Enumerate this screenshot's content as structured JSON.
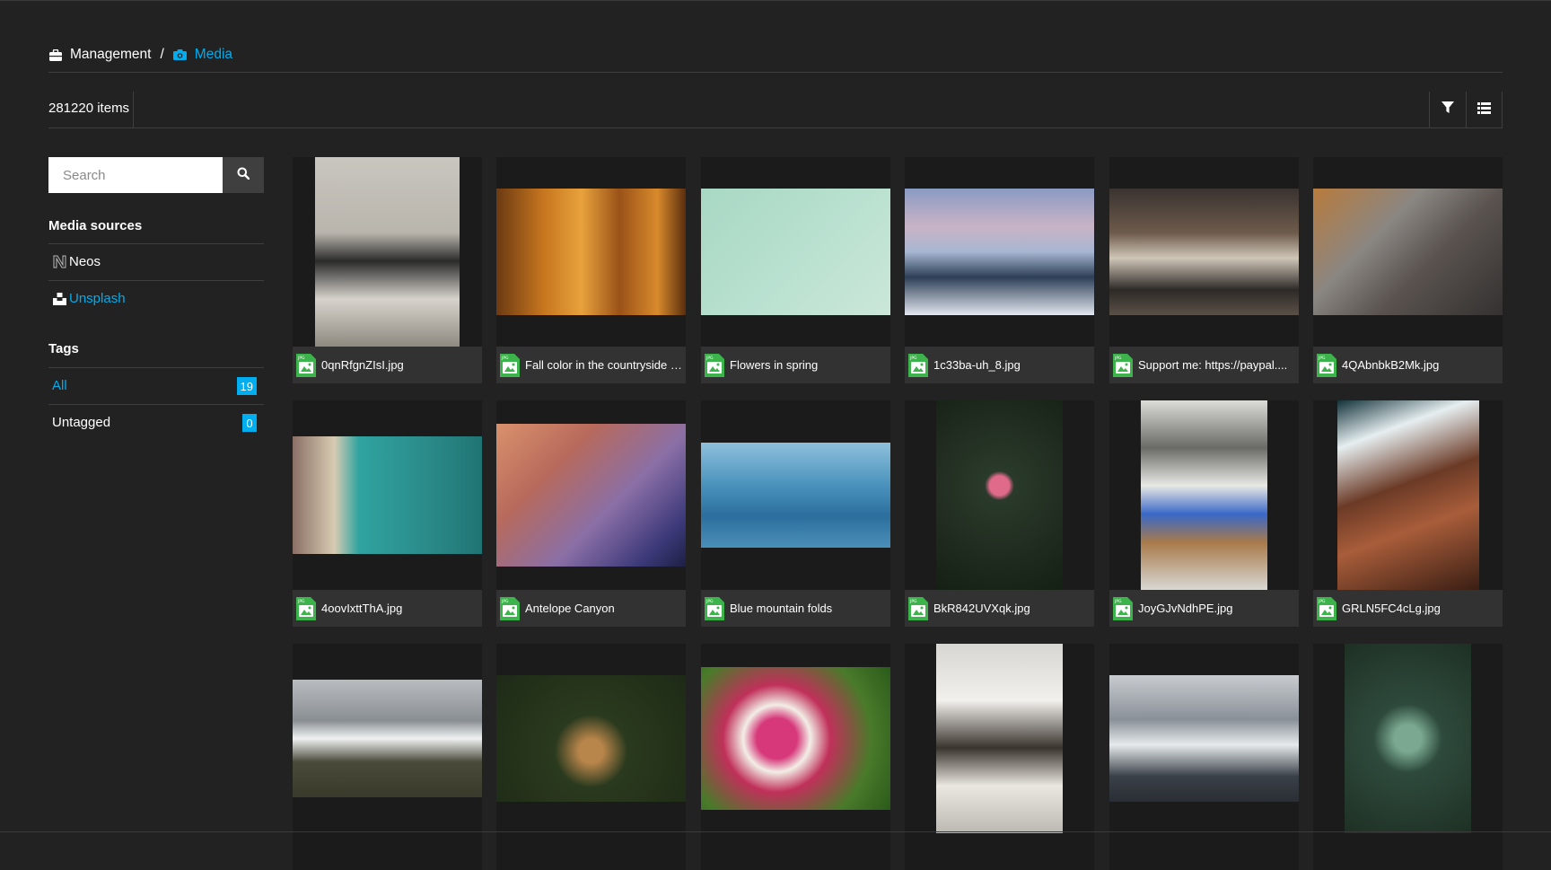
{
  "breadcrumb": {
    "parent": "Management",
    "separator": "/",
    "current": "Media"
  },
  "toolbar": {
    "count_label": "281220 items",
    "filter_icon": "filter-icon",
    "list_icon": "list-view-icon"
  },
  "sidebar": {
    "search_placeholder": "Search",
    "sources_heading": "Media sources",
    "sources": [
      {
        "label": "Neos",
        "icon": "neos-logo-icon",
        "active": false
      },
      {
        "label": "Unsplash",
        "icon": "unsplash-logo-icon",
        "active": true
      }
    ],
    "tags_heading": "Tags",
    "tags": [
      {
        "label": "All",
        "count": "19",
        "active": true
      },
      {
        "label": "Untagged",
        "count": "0",
        "active": false
      }
    ]
  },
  "assets": [
    {
      "name": "0qnRfgnZIsI.jpg"
    },
    {
      "name": "Fall color in the countryside o..."
    },
    {
      "name": "Flowers in spring"
    },
    {
      "name": "1c33ba-uh_8.jpg"
    },
    {
      "name": "Support me: https://paypal...."
    },
    {
      "name": "4QAbnbkB2Mk.jpg"
    },
    {
      "name": "4oovIxttThA.jpg"
    },
    {
      "name": "Antelope Canyon"
    },
    {
      "name": "Blue mountain folds"
    },
    {
      "name": "BkR842UVXqk.jpg"
    },
    {
      "name": "JoyGJvNdhPE.jpg"
    },
    {
      "name": "GRLN5FC4cLg.jpg"
    },
    {
      "name": ""
    },
    {
      "name": ""
    },
    {
      "name": ""
    },
    {
      "name": ""
    },
    {
      "name": ""
    },
    {
      "name": ""
    }
  ],
  "colors": {
    "accent": "#00adee",
    "background": "#222222",
    "caption": "#323232",
    "file_icon_green": "#3cb44b"
  }
}
